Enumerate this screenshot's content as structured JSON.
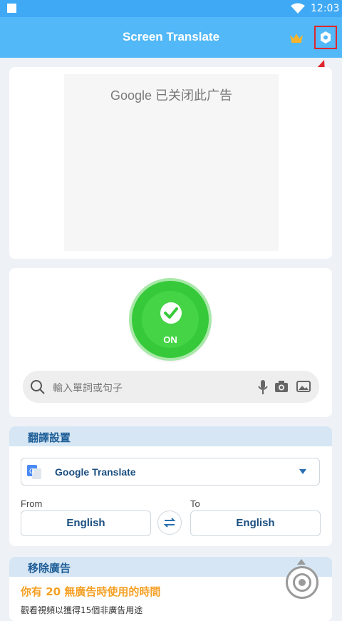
{
  "status_bar": {
    "time": "12:03"
  },
  "app_bar": {
    "title": "Screen Translate"
  },
  "ad": {
    "brand": "Google",
    "text": "已关闭此广告"
  },
  "toggle": {
    "label": "ON"
  },
  "search": {
    "placeholder": "輸入單詞或句子"
  },
  "translation_settings": {
    "header": "翻譯設置",
    "engine": "Google Translate",
    "from_label": "From",
    "to_label": "To",
    "from_lang": "English",
    "to_lang": "English"
  },
  "remove_ads": {
    "header": "移除廣告",
    "promo": "你有 20 無廣告時使用的時間",
    "subtext": "觀看視頻以獲得15個非廣告用途"
  },
  "colors": {
    "primary": "#52b8f7",
    "on_green": "#36c93a",
    "accent_orange": "#f4a024",
    "highlight_red": "#e0262c"
  }
}
